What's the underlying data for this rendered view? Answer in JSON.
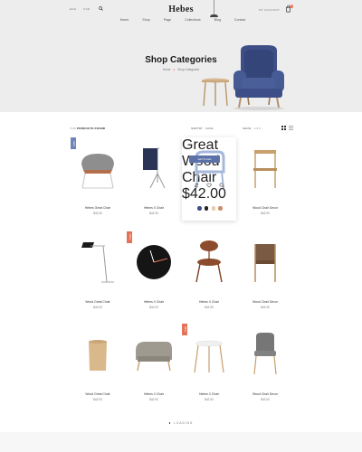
{
  "header": {
    "languages": [
      "ENG",
      "USD"
    ],
    "logo": "Hebes",
    "account_label": "MY ACCOUNT",
    "cart_count": "0",
    "nav": [
      "Home",
      "Shop",
      "Page",
      "Collections",
      "Blog",
      "Contact"
    ]
  },
  "hero": {
    "title": "Shop Categories",
    "breadcrumb": [
      "Home",
      "Shop Categories"
    ],
    "chair_color": "#3d4f86"
  },
  "toolbar": {
    "count_text": "YOU",
    "count_bold": "PRODUCTS FOUND",
    "sort_label": "SORT BY",
    "sort_value": "NAME",
    "show_label": "SHOW",
    "show_pages": "1  2  3"
  },
  "products": [
    {
      "name": "Hebes Great Chair",
      "price": "$42.00",
      "tag": "NEW"
    },
    {
      "name": "Hebes X Chair",
      "price": "$42.00",
      "tag": ""
    },
    {
      "name": "Great Wood Chair",
      "price": "$42.00",
      "tag": ""
    },
    {
      "name": "Wood Chair Decor",
      "price": "$42.00",
      "tag": ""
    },
    {
      "name": "Wood Great Chair",
      "price": "$42.00",
      "tag": ""
    },
    {
      "name": "Hebes X Chair",
      "price": "$42.00",
      "tag": "SALE"
    },
    {
      "name": "Hebes X Chair",
      "price": "$42.00",
      "tag": ""
    },
    {
      "name": "Wood Chair Decor",
      "price": "$42.00",
      "tag": ""
    },
    {
      "name": "Wood Great Chair",
      "price": "$42.00",
      "tag": ""
    },
    {
      "name": "Hebes X Chair",
      "price": "$42.00",
      "tag": ""
    },
    {
      "name": "Hebes X Chair",
      "price": "$42.00",
      "tag": "SALE"
    },
    {
      "name": "Wood Chair Decor",
      "price": "$42.00",
      "tag": ""
    }
  ],
  "hover_card": {
    "add_to_cart": "Add To Cart",
    "swatches": [
      "#3d4f86",
      "#222222",
      "#e7c9a5",
      "#c98b6a"
    ]
  },
  "footer": {
    "loading": "LOADING"
  },
  "colors": {
    "accent": "#e4735a",
    "primary": "#5b71a8",
    "header_bg": "#ededed"
  }
}
